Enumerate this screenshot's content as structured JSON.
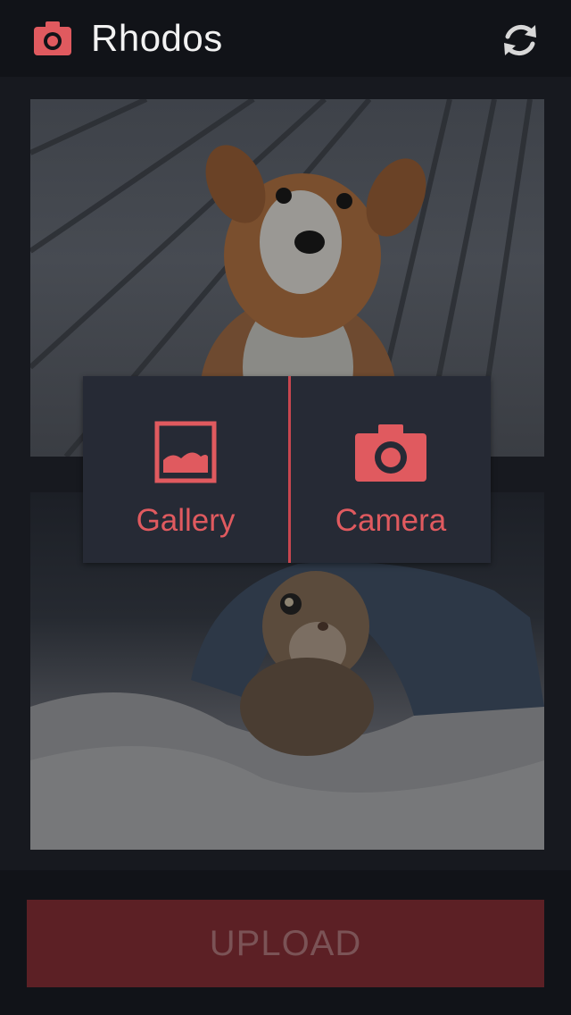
{
  "action_bar": {
    "title": "Rhodos",
    "app_icon": "camera-icon",
    "refresh_icon": "refresh-icon"
  },
  "photos": [
    {
      "subject": "puppy"
    },
    {
      "subject": "kitten"
    }
  ],
  "picker": {
    "gallery_label": "Gallery",
    "gallery_icon": "image-icon",
    "camera_label": "Camera",
    "camera_icon": "camera-icon"
  },
  "upload": {
    "label": "UPLOAD"
  },
  "colors": {
    "accent": "#e05a5f",
    "upload_bg": "#5c2025",
    "dialog_bg": "#262a35",
    "bar_bg": "#111318"
  }
}
